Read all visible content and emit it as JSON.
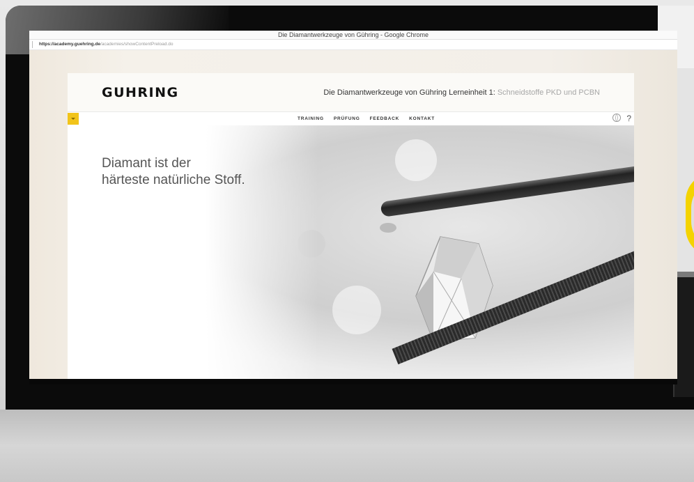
{
  "browser": {
    "window_title": "Die Diamantwerkzeuge von Gühring - Google Chrome",
    "url_domain": "https://academy.guehring.de",
    "url_path": "/academies/showContentPreload.do"
  },
  "app": {
    "logo": "GUHRING",
    "course_title": "Die Diamantwerkzeuge von Gühring Lerneinheit 1:",
    "course_subtitle": "Schneidstoffe PKD und PCBN",
    "nav": {
      "training": "TRAINING",
      "pruefung": "PRÜFUNG",
      "feedback": "FEEDBACK",
      "kontakt": "KONTAKT"
    },
    "help_label": "?"
  },
  "hero": {
    "headline_line1": "Diamant ist der",
    "headline_line2": "härteste natürliche Stoff."
  },
  "colors": {
    "accent": "#f2c41a",
    "logo": "#111111"
  },
  "icons": [
    "menu-chevron-icon",
    "globe-icon",
    "help-icon"
  ]
}
